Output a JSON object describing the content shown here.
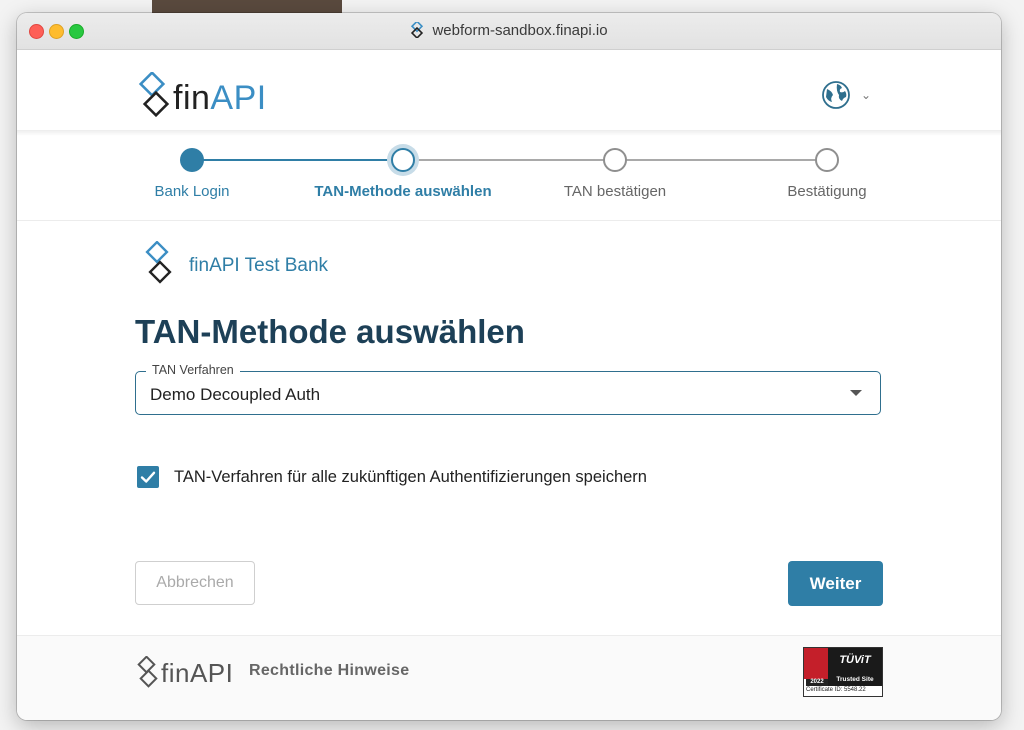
{
  "browser": {
    "url": "webform-sandbox.finapi.io"
  },
  "header": {
    "logo_fin": "fin",
    "logo_api": "API"
  },
  "stepper": {
    "active_color": "#2f7ea6",
    "steps": [
      {
        "label": "Bank Login",
        "state": "done"
      },
      {
        "label": "TAN-Methode auswählen",
        "state": "current"
      },
      {
        "label": "TAN bestätigen",
        "state": "pending"
      },
      {
        "label": "Bestätigung",
        "state": "pending"
      }
    ]
  },
  "bank": {
    "name": "finAPI Test Bank"
  },
  "page": {
    "title": "TAN-Methode auswählen"
  },
  "tan_select": {
    "legend": "TAN Verfahren",
    "value": "Demo Decoupled Auth"
  },
  "save_option": {
    "label": "TAN-Verfahren für alle zukünftigen Authentifizierungen speichern",
    "checked": true
  },
  "actions": {
    "cancel_label": "Abbrechen",
    "next_label": "Weiter"
  },
  "footer": {
    "logo_fin": "fin",
    "logo_api": "API",
    "legal_link": "Rechtliche Hinweise",
    "seal": {
      "brand": "TÜViT",
      "trusted": "Trusted Site",
      "year": "2022",
      "cert": "Certificate ID: 5548.22"
    }
  },
  "colors": {
    "brand": "#2f7ea6",
    "title": "#1d4057",
    "logo_api": "#3b8ec4"
  }
}
